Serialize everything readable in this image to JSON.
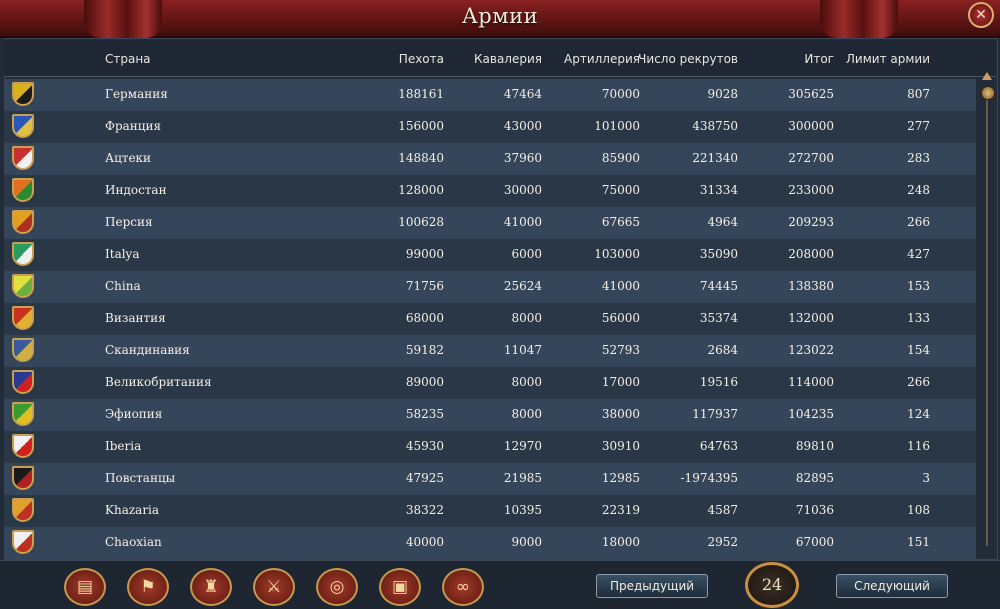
{
  "window": {
    "title": "Армии"
  },
  "columns": {
    "country": "Страна",
    "infantry": "Пехота",
    "cavalry": "Кавалерия",
    "artillery": "Артиллерия",
    "recruits": "Число рекрутов",
    "total": "Итог",
    "limit": "Лимит армии"
  },
  "rows": [
    {
      "country": "Германия",
      "infantry": "188161",
      "cavalry": "47464",
      "artillery": "70000",
      "recruits": "9028",
      "total": "305625",
      "limit": "807",
      "flag_colors": [
        "#d8b020",
        "#1a1a1a"
      ]
    },
    {
      "country": "Франция",
      "infantry": "156000",
      "cavalry": "43000",
      "artillery": "101000",
      "recruits": "438750",
      "total": "300000",
      "limit": "277",
      "flag_colors": [
        "#2a58b8",
        "#e0c040"
      ]
    },
    {
      "country": "Ацтеки",
      "infantry": "148840",
      "cavalry": "37960",
      "artillery": "85900",
      "recruits": "221340",
      "total": "272700",
      "limit": "283",
      "flag_colors": [
        "#c83030",
        "#f0f0f0"
      ]
    },
    {
      "country": "Индостан",
      "infantry": "128000",
      "cavalry": "30000",
      "artillery": "75000",
      "recruits": "31334",
      "total": "233000",
      "limit": "248",
      "flag_colors": [
        "#e07020",
        "#2a8a30"
      ]
    },
    {
      "country": "Персия",
      "infantry": "100628",
      "cavalry": "41000",
      "artillery": "67665",
      "recruits": "4964",
      "total": "209293",
      "limit": "266",
      "flag_colors": [
        "#e0a020",
        "#b03020"
      ]
    },
    {
      "country": "Italya",
      "infantry": "99000",
      "cavalry": "6000",
      "artillery": "103000",
      "recruits": "35090",
      "total": "208000",
      "limit": "427",
      "flag_colors": [
        "#2a9a60",
        "#f0f0f0"
      ]
    },
    {
      "country": "China",
      "infantry": "71756",
      "cavalry": "25624",
      "artillery": "41000",
      "recruits": "74445",
      "total": "138380",
      "limit": "153",
      "flag_colors": [
        "#e0e040",
        "#6ab040"
      ]
    },
    {
      "country": "Византия",
      "infantry": "68000",
      "cavalry": "8000",
      "artillery": "56000",
      "recruits": "35374",
      "total": "132000",
      "limit": "133",
      "flag_colors": [
        "#c83020",
        "#e0b030"
      ]
    },
    {
      "country": "Скандинавия",
      "infantry": "59182",
      "cavalry": "11047",
      "artillery": "52793",
      "recruits": "2684",
      "total": "123022",
      "limit": "154",
      "flag_colors": [
        "#3a5aa0",
        "#d0b040"
      ]
    },
    {
      "country": "Великобритания",
      "infantry": "89000",
      "cavalry": "8000",
      "artillery": "17000",
      "recruits": "19516",
      "total": "114000",
      "limit": "266",
      "flag_colors": [
        "#2a3a90",
        "#d02020"
      ]
    },
    {
      "country": "Эфиопия",
      "infantry": "58235",
      "cavalry": "8000",
      "artillery": "38000",
      "recruits": "117937",
      "total": "104235",
      "limit": "124",
      "flag_colors": [
        "#3a9a30",
        "#e0c020"
      ]
    },
    {
      "country": "Iberia",
      "infantry": "45930",
      "cavalry": "12970",
      "artillery": "30910",
      "recruits": "64763",
      "total": "89810",
      "limit": "116",
      "flag_colors": [
        "#f0f0f0",
        "#d02020"
      ]
    },
    {
      "country": "Повстанцы",
      "infantry": "47925",
      "cavalry": "21985",
      "artillery": "12985",
      "recruits": "-1974395",
      "total": "82895",
      "limit": "3",
      "flag_colors": [
        "#1a1a1a",
        "#b02020"
      ]
    },
    {
      "country": "Khazaria",
      "infantry": "38322",
      "cavalry": "10395",
      "artillery": "22319",
      "recruits": "4587",
      "total": "71036",
      "limit": "108",
      "flag_colors": [
        "#e0a030",
        "#c03020"
      ]
    },
    {
      "country": "Chaoxian",
      "infantry": "40000",
      "cavalry": "9000",
      "artillery": "18000",
      "recruits": "2952",
      "total": "67000",
      "limit": "151",
      "flag_colors": [
        "#f0f0f0",
        "#c03020"
      ]
    }
  ],
  "toolbar_icons": [
    {
      "name": "ledger-icon",
      "glyph": "▤"
    },
    {
      "name": "flag-icon",
      "glyph": "⚑"
    },
    {
      "name": "buildings-icon",
      "glyph": "♜"
    },
    {
      "name": "crossed-swords-icon",
      "glyph": "⚔"
    },
    {
      "name": "coins-icon",
      "glyph": "◎"
    },
    {
      "name": "trade-goods-icon",
      "glyph": "▣"
    },
    {
      "name": "handshake-icon",
      "glyph": "∞"
    }
  ],
  "nav": {
    "prev_label": "Предыдущий",
    "next_label": "Следующий",
    "page": "24"
  },
  "close_glyph": "✕"
}
